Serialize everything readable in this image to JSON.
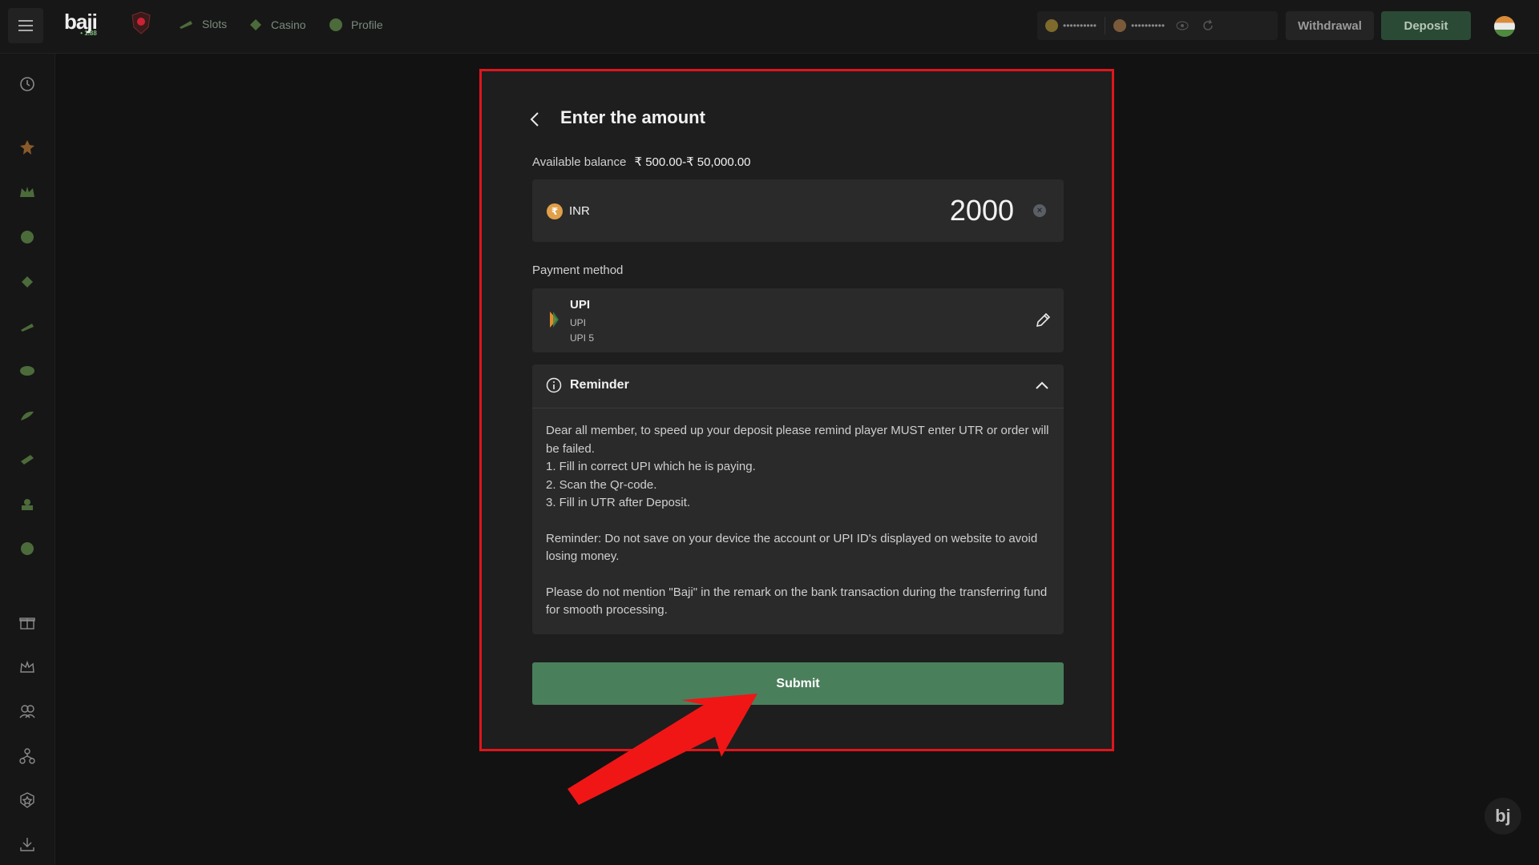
{
  "header": {
    "logo_text": "baji",
    "logo_sub": "• 1.88",
    "nav": [
      {
        "label": "Slots",
        "icon": "slots-icon"
      },
      {
        "label": "Casino",
        "icon": "casino-icon"
      },
      {
        "label": "Profile",
        "icon": "profile-icon"
      }
    ],
    "balance_masked_1": "••••••••••",
    "balance_masked_2": "••••••••••",
    "withdraw_label": "Withdrawal",
    "deposit_label": "Deposit"
  },
  "modal": {
    "title": "Enter the amount",
    "available_balance_label": "Available balance",
    "available_balance_range": "₹ 500.00-₹ 50,000.00",
    "currency": "INR",
    "amount": "2000",
    "payment_method_label": "Payment method",
    "payment_method": {
      "name": "UPI",
      "sub1": "UPI",
      "sub2": "UPI 5"
    },
    "reminder": {
      "title": "Reminder",
      "lines": [
        " Dear all member, to speed up your deposit please remind player MUST enter UTR or order will be failed.",
        "1. Fill in correct UPI which he is paying.",
        "2. Scan the Qr-code.",
        "3. Fill in UTR after Deposit."
      ],
      "para2": "Reminder: Do not save on your device the account or UPI ID's displayed on website to avoid losing money.",
      "para3": "Please do not mention \"Baji\" in the remark on the bank transaction during the transferring fund for smooth processing."
    },
    "submit_label": "Submit"
  },
  "corner_logo": "bj",
  "colors": {
    "highlight_border": "#e0151b",
    "submit_bg": "#4a7f5c",
    "arrow": "#f01616"
  }
}
